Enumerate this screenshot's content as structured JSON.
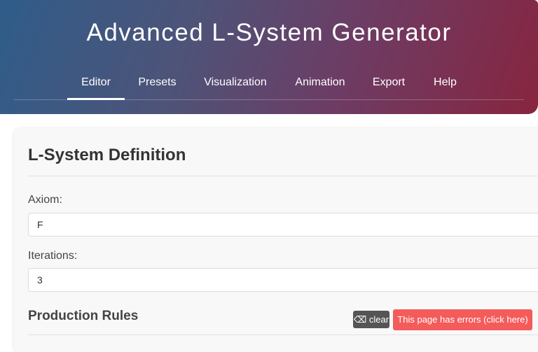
{
  "header": {
    "title": "Advanced L-System Generator",
    "tabs": [
      {
        "label": "Editor",
        "active": true
      },
      {
        "label": "Presets",
        "active": false
      },
      {
        "label": "Visualization",
        "active": false
      },
      {
        "label": "Animation",
        "active": false
      },
      {
        "label": "Export",
        "active": false
      },
      {
        "label": "Help",
        "active": false
      }
    ]
  },
  "definition": {
    "title": "L-System Definition",
    "axiom_label": "Axiom:",
    "axiom_value": "F",
    "iterations_label": "Iterations:",
    "iterations_value": "3",
    "rules_title": "Production Rules"
  },
  "overlay": {
    "clear_label": "clear",
    "clear_icon": "broom-icon",
    "error_label": "This page has errors (click here)"
  },
  "colors": {
    "header_gradient_start": "#2f5d8a",
    "header_gradient_end": "#87253f",
    "error_button": "#f45b5b",
    "clear_button": "#555555"
  }
}
